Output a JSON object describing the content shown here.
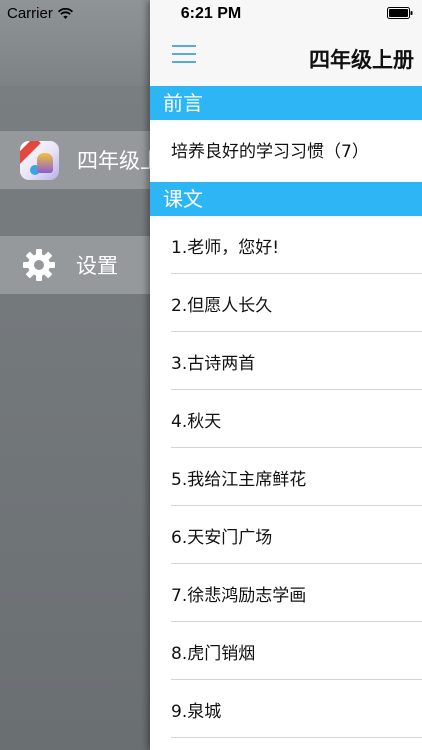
{
  "status_bar": {
    "carrier": "Carrier",
    "time": "6:21 PM"
  },
  "drawer": {
    "items": [
      {
        "label": "四年级上册",
        "icon": "app-icon"
      },
      {
        "label": "设置",
        "icon": "gear-icon"
      }
    ]
  },
  "nav": {
    "title": "四年级上册",
    "menu_icon": "hamburger-menu-icon",
    "accent_color": "#5aa8dc"
  },
  "sections": {
    "preface": {
      "header": "前言",
      "rows": [
        "培养良好的学习习惯（7）"
      ]
    },
    "texts": {
      "header": "课文",
      "rows": [
        "1.老师，您好!",
        "2.但愿人长久",
        "3.古诗两首",
        "4.秋天",
        "5.我给江主席鲜花",
        "6.天安门广场",
        "7.徐悲鸿励志学画",
        "8.虎门销烟",
        "9.泉城"
      ]
    },
    "header_color": "#2db6f5"
  }
}
